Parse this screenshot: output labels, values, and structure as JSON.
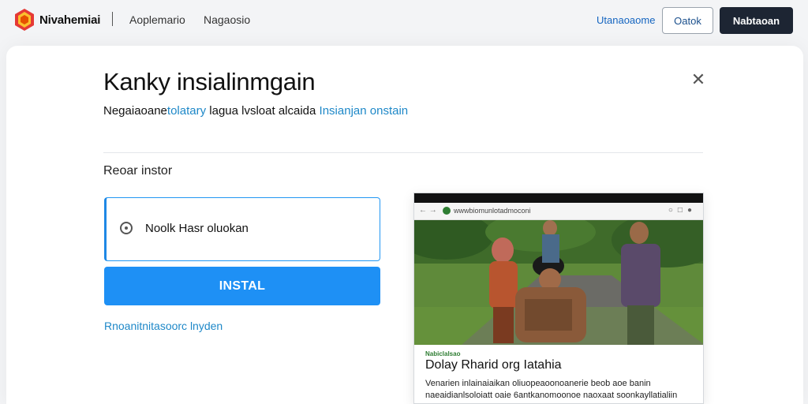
{
  "nav": {
    "brand": "Nivahemiai",
    "link1": "Aoplemario",
    "link2": "Nagaosio",
    "right_link": "Utanaoaome",
    "outline_button": "Oatok",
    "dark_button": "Nabtaoan"
  },
  "modal": {
    "title": "Kanky insialinmgain",
    "subtitle_plain": "Negaiaoane",
    "subtitle_link1": "tolatary",
    "subtitle_mid": " lagua lvsloat alcaida ",
    "subtitle_link2": "Insianjan onstain",
    "section_label": "Reoar instor",
    "option_text": "Noolk Hasr oluokan",
    "install_button": "INSTAL",
    "help_link": "Rnoanitnitasoorc lnyden"
  },
  "preview": {
    "url": "wwwbiomunlotadmoconi",
    "kicker": "Nabiclalsao",
    "headline": "Dolay Rharid org Iatahia",
    "body": "Venarien inlainaiaikan oliuopeaoonoanerie beob aoe banin naeaidianlsoloiatt oaie 6antkanomoonoe naoxaat soonkayllatialiin"
  },
  "colors": {
    "primary": "#1e90f5",
    "link": "#1e88c8",
    "dark_button": "#1d2533"
  },
  "icons": {
    "logo": "brand-logo-icon",
    "close": "close-icon",
    "radio": "radio-icon"
  }
}
